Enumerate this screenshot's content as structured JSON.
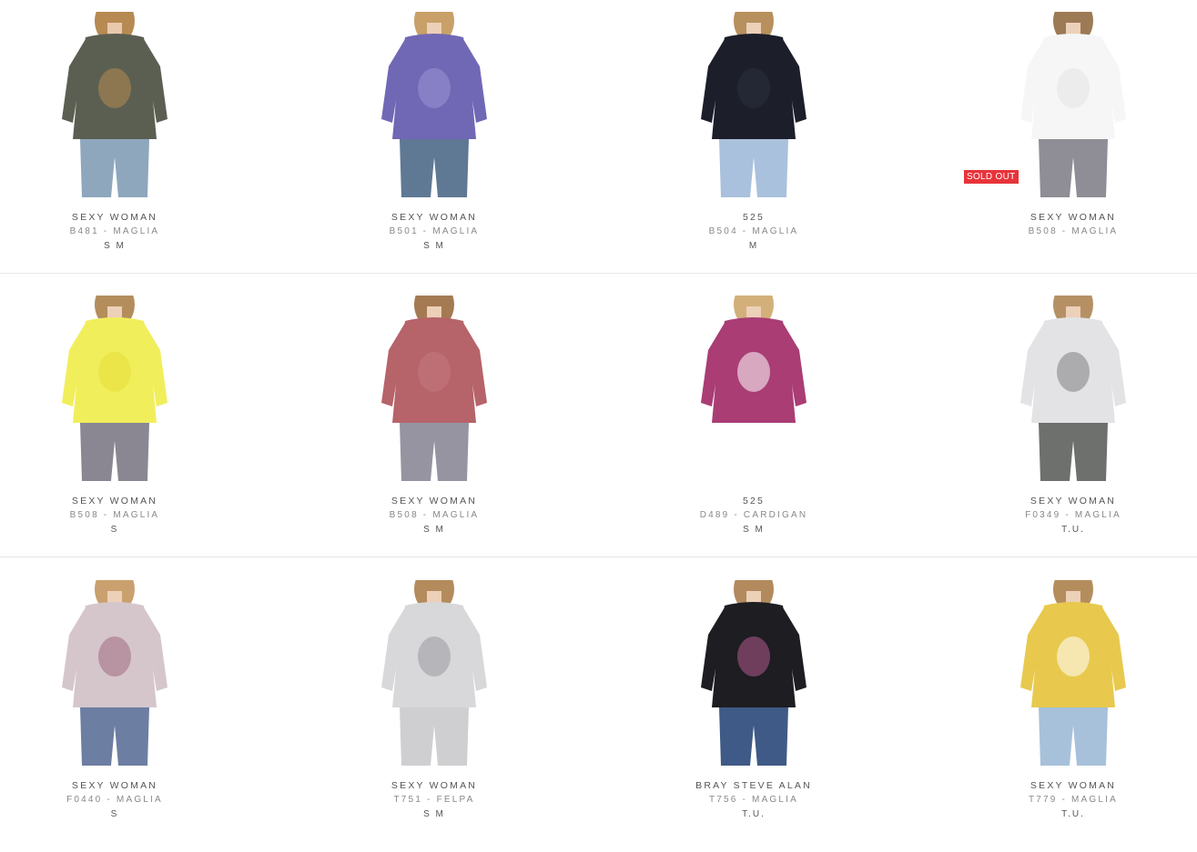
{
  "products": [
    {
      "brand": "SEXY WOMAN",
      "model": "B481 - MAGLIA",
      "sizes": "S M",
      "top": "#5b5f52",
      "accent": "#b58a50",
      "bottom": "#8ea7bd",
      "skin": "#e9c9ad",
      "hair": "#b78a52",
      "sold_out": ""
    },
    {
      "brand": "SEXY WOMAN",
      "model": "B501 - MAGLIA",
      "sizes": "S M",
      "top": "#7068b4",
      "accent": "#9a93d6",
      "bottom": "#5f7894",
      "skin": "#ecd0b8",
      "hair": "#c8a068",
      "sold_out": ""
    },
    {
      "brand": "525",
      "model": "B504 - MAGLIA",
      "sizes": "M",
      "top": "#1c1f2a",
      "accent": "#2b2f3c",
      "bottom": "#a9c1dc",
      "skin": "#ecd0b8",
      "hair": "#b7905e",
      "sold_out": ""
    },
    {
      "brand": "SEXY WOMAN",
      "model": "B508 - MAGLIA",
      "sizes": "",
      "top": "#f6f6f6",
      "accent": "#e4e4e4",
      "bottom": "#8f8d95",
      "skin": "#ecd0b8",
      "hair": "#9c7a55",
      "sold_out": "SOLD OUT"
    },
    {
      "brand": "SEXY WOMAN",
      "model": "B508 - MAGLIA",
      "sizes": "S",
      "top": "#f1ee5c",
      "accent": "#e5df3c",
      "bottom": "#8a8792",
      "skin": "#ecd0b8",
      "hair": "#b48d5c",
      "sold_out": ""
    },
    {
      "brand": "SEXY WOMAN",
      "model": "B508 - MAGLIA",
      "sizes": "S M",
      "top": "#b6636a",
      "accent": "#c47a80",
      "bottom": "#9594a0",
      "skin": "#ecd0b8",
      "hair": "#a47a52",
      "sold_out": ""
    },
    {
      "brand": "525",
      "model": "D489 - CARDIGAN",
      "sizes": "S M",
      "top": "#a93d74",
      "accent": "#ffffff",
      "bottom": "#ffffff",
      "skin": "#ecd0b8",
      "hair": "#d3b07a",
      "sold_out": ""
    },
    {
      "brand": "SEXY WOMAN",
      "model": "F0349 - MAGLIA",
      "sizes": "T.U.",
      "top": "#e3e3e5",
      "accent": "#7f7f83",
      "bottom": "#6e706e",
      "skin": "#ecd0b8",
      "hair": "#b69065",
      "sold_out": ""
    },
    {
      "brand": "SEXY WOMAN",
      "model": "F0440 - MAGLIA",
      "sizes": "S",
      "top": "#d5c6cc",
      "accent": "#a06a7e",
      "bottom": "#6c7ea2",
      "skin": "#ecd0b8",
      "hair": "#c9a06e",
      "sold_out": ""
    },
    {
      "brand": "SEXY WOMAN",
      "model": "T751 - FELPA",
      "sizes": "S M",
      "top": "#d8d8da",
      "accent": "#9b9ba0",
      "bottom": "#cfcfd2",
      "skin": "#ecd0b8",
      "hair": "#b48b5c",
      "sold_out": ""
    },
    {
      "brand": "BRAY STEVE ALAN",
      "model": "T756 - MAGLIA",
      "sizes": "T.U.",
      "top": "#1d1d22",
      "accent": "#b45a8e",
      "bottom": "#3f5a86",
      "skin": "#ecd0b8",
      "hair": "#b28a5e",
      "sold_out": ""
    },
    {
      "brand": "SEXY WOMAN",
      "model": "T779 - MAGLIA",
      "sizes": "T.U.",
      "top": "#e8c94e",
      "accent": "#ffffff",
      "bottom": "#a7c1da",
      "skin": "#ecd0b8",
      "hair": "#b48d5c",
      "sold_out": ""
    }
  ]
}
